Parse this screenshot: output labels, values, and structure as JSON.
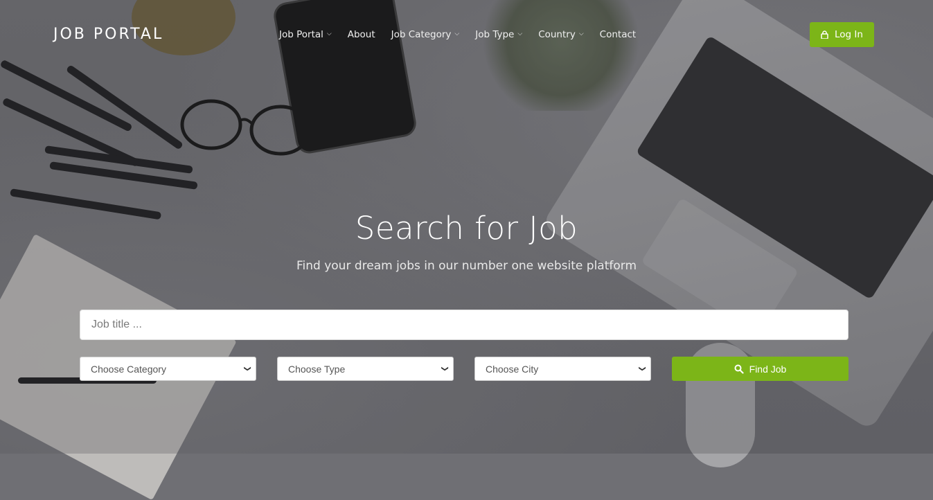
{
  "header": {
    "brand": "JOB PORTAL",
    "nav": [
      {
        "label": "Job Portal",
        "dropdown": true
      },
      {
        "label": "About",
        "dropdown": false
      },
      {
        "label": "Job Category",
        "dropdown": true
      },
      {
        "label": "Job Type",
        "dropdown": true
      },
      {
        "label": "Country",
        "dropdown": true
      },
      {
        "label": "Contact",
        "dropdown": false
      }
    ],
    "login_label": "Log In",
    "login_icon": "lock-icon"
  },
  "hero": {
    "title": "Search for Job",
    "subtitle": "Find your dream jobs in our number one website platform"
  },
  "search": {
    "job_title_placeholder": "Job title ...",
    "category_selected": "Choose Category",
    "type_selected": "Choose Type",
    "city_selected": "Choose City",
    "find_label": "Find Job",
    "find_icon": "search-icon"
  },
  "colors": {
    "accent": "#7cb518",
    "text_light": "#ffffff"
  }
}
